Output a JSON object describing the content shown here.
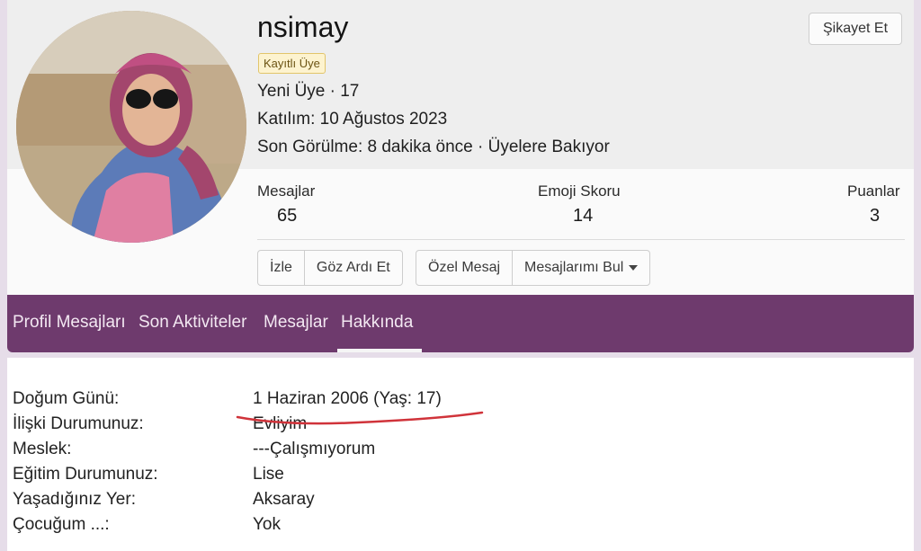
{
  "profile": {
    "username": "nsimay",
    "badge": "Kayıtlı Üye",
    "rank": "Yeni Üye · 17",
    "joined": "Katılım: 10 Ağustos 2023",
    "last_seen": "Son Görülme: 8 dakika önce · Üyelere Bakıyor",
    "report_label": "Şikayet Et"
  },
  "stats": [
    {
      "label": "Mesajlar",
      "value": "65"
    },
    {
      "label": "Emoji Skoru",
      "value": "14"
    },
    {
      "label": "Puanlar",
      "value": "3"
    }
  ],
  "actions": {
    "follow": "İzle",
    "ignore": "Göz Ardı Et",
    "private_message": "Özel Mesaj",
    "find_messages": "Mesajlarımı Bul"
  },
  "tabs": [
    "Profil Mesajları",
    "Son Aktiviteler",
    "Mesajlar",
    "Hakkında"
  ],
  "active_tab": "Hakkında",
  "about": [
    {
      "label": "Doğum Günü:",
      "value": "1 Haziran 2006 (Yaş: 17)"
    },
    {
      "label": "İlişki Durumunuz:",
      "value": "Evliyim"
    },
    {
      "label": "Meslek:",
      "value": "---Çalışmıyorum"
    },
    {
      "label": "Eğitim Durumunuz:",
      "value": "Lise"
    },
    {
      "label": "Yaşadığınız Yer:",
      "value": "Aksaray"
    },
    {
      "label": "Çocuğum ...:",
      "value": "Yok"
    }
  ],
  "colors": {
    "tab_bar": "#6e3a6d",
    "annotation_stroke": "#d0333a"
  }
}
